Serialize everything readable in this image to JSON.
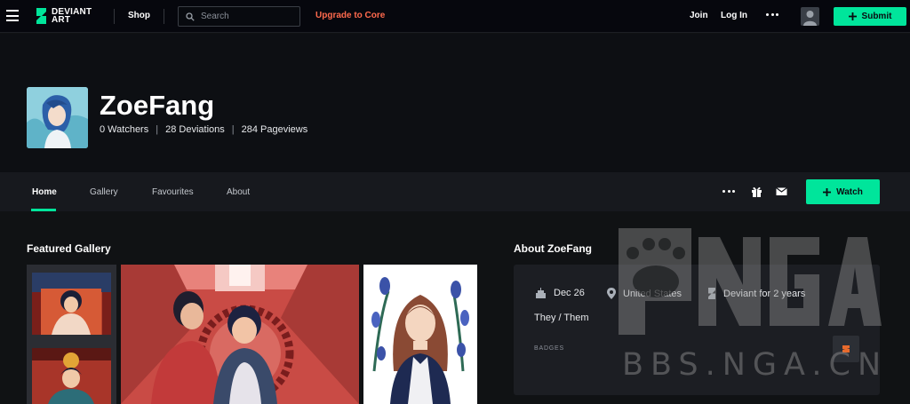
{
  "topnav": {
    "logo_line1": "DEVIANT",
    "logo_line2": "ART",
    "shop_label": "Shop",
    "search_placeholder": "Search",
    "upgrade_label": "Upgrade to Core",
    "join_label": "Join",
    "login_label": "Log In",
    "submit_label": "Submit"
  },
  "profile": {
    "username": "ZoeFang",
    "watchers": "0 Watchers",
    "deviations": "28 Deviations",
    "pageviews": "284 Pageviews"
  },
  "tabs": [
    {
      "label": "Home",
      "active": true
    },
    {
      "label": "Gallery",
      "active": false
    },
    {
      "label": "Favourites",
      "active": false
    },
    {
      "label": "About",
      "active": false
    }
  ],
  "watch_label": "Watch",
  "featured": {
    "title": "Featured Gallery"
  },
  "about": {
    "title": "About ZoeFang",
    "birthday": "Dec 26",
    "location": "United States",
    "member_since": "Deviant for 2 years",
    "pronouns": "They / Them",
    "badges_label": "BADGES"
  },
  "watermark": {
    "text": "BBS.NGA.CN",
    "logo_text": "NGA"
  },
  "colors": {
    "accent": "#00e59b",
    "upgrade": "#ff6a4d",
    "background": "#101214"
  },
  "icons": [
    "menu-icon",
    "deviantart-logo-icon",
    "search-icon",
    "more-icon",
    "user-icon",
    "plus-icon",
    "gift-icon",
    "mail-icon",
    "cake-icon",
    "location-icon",
    "deviantart-icon",
    "badge-icon"
  ]
}
